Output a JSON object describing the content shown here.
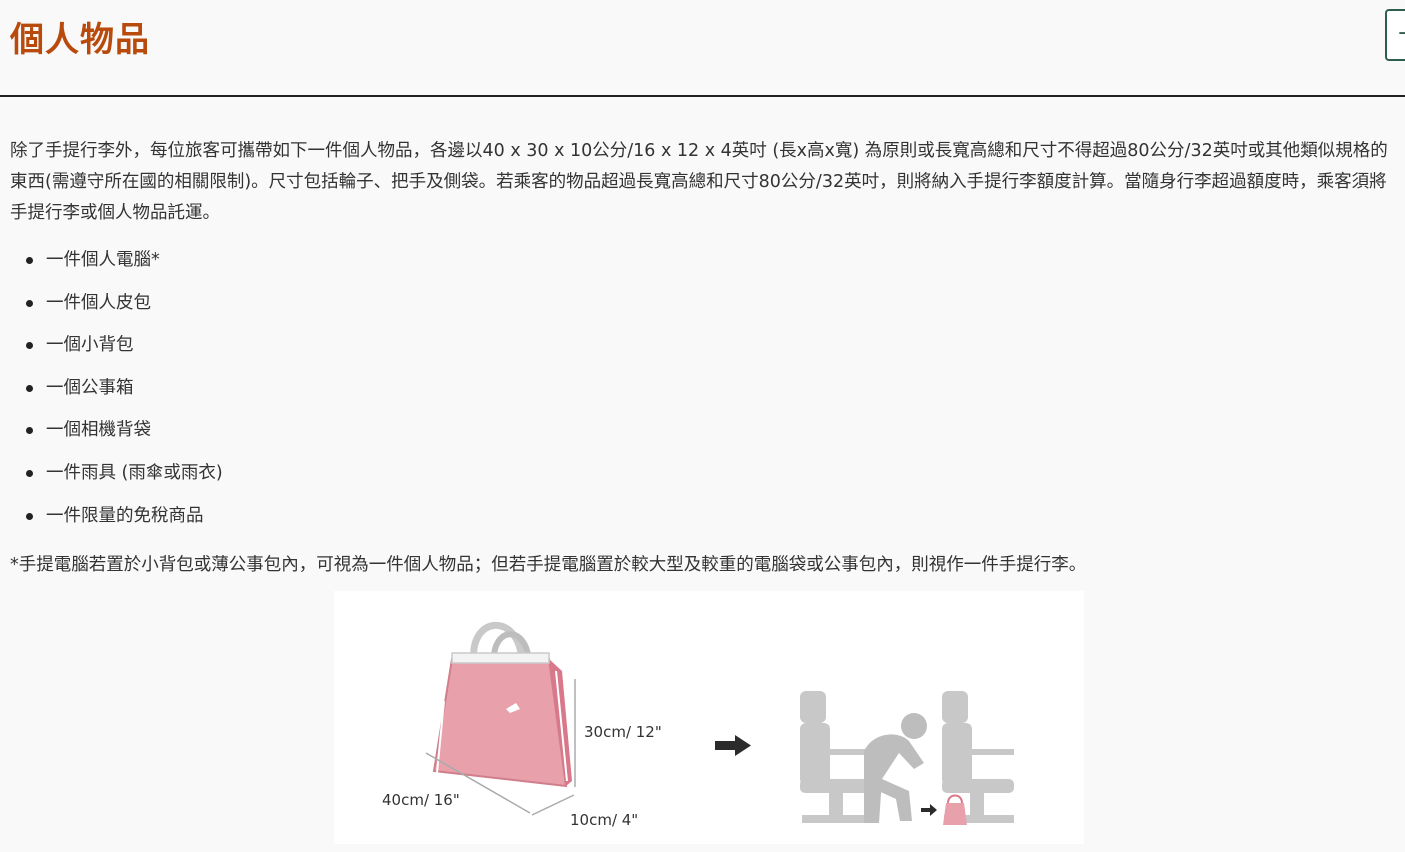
{
  "header": {
    "title": "個人物品",
    "expand_glyph": "+"
  },
  "intro": "除了手提行李外，每位旅客可攜帶如下一件個人物品，各邊以40 x 30 x 10公分/16 x 12 x 4英吋 (長x高x寬) 為原則或長寬高總和尺寸不得超過80公分/32英吋或其他類似規格的東西(需遵守所在國的相關限制)。尺寸包括輪子、把手及側袋。若乘客的物品超過長寬高總和尺寸80公分/32英吋，則將納入手提行李額度計算。當隨身行李超過額度時，乘客須將手提行李或個人物品託運。",
  "items": [
    "一件個人電腦*",
    "一件個人皮包",
    "一個小背包",
    "一個公事箱",
    "一個相機背袋",
    "一件雨具 (雨傘或雨衣)",
    "一件限量的免稅商品"
  ],
  "note": "*手提電腦若置於小背包或薄公事包內，可視為一件個人物品；但若手提電腦置於較大型及較重的電腦袋或公事包內，則視作一件手提行李。",
  "figure": {
    "height_label": "30cm/ 12\"",
    "length_label": "40cm/ 16\"",
    "width_label": "10cm/ 4\"",
    "icons": [
      "handbag-icon",
      "arrow-right-icon",
      "seat-icon",
      "passenger-icon"
    ],
    "colors": {
      "bag": "#e8a1ab",
      "bag_dark": "#d9788a",
      "seat": "#c8c8c8",
      "arrow": "#2b2b2b"
    }
  },
  "colors": {
    "title": "#b84a0c",
    "text": "#333333",
    "button_border": "#2e5e4e"
  }
}
